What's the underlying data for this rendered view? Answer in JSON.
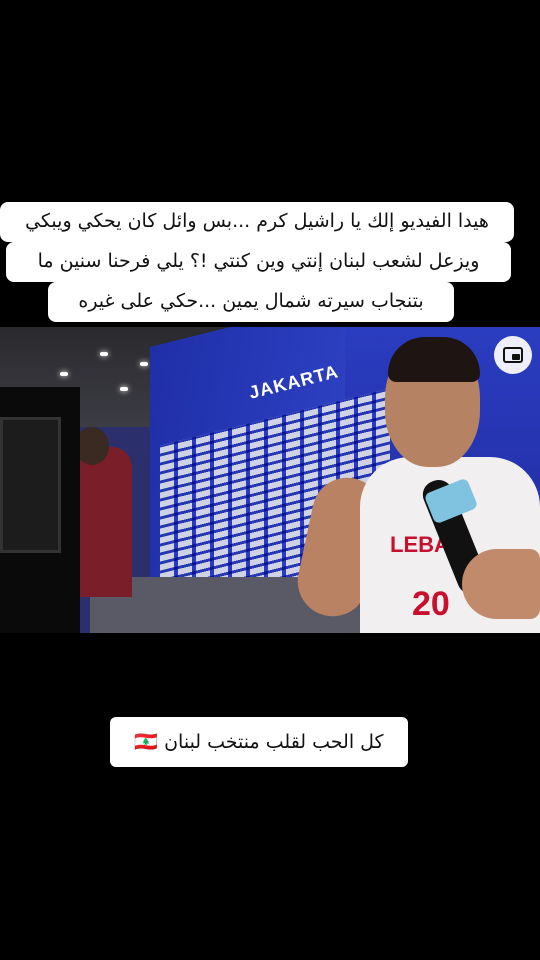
{
  "captions": {
    "line1": "هيدا الفيديو إلك يا راشيل كرم ...بس وائل كان يحكي ويبكي",
    "line2": "ويزعل لشعب لبنان إنتي وين كنتي !؟ يلي فرحنا سنين ما",
    "line3": "بتنجاب سيرته شمال يمين ...حكي على غيره"
  },
  "video": {
    "scene_text": "JAKARTA",
    "jersey_text": "LEBAN",
    "jersey_number": "20",
    "pip_icon": "picture-in-picture-icon"
  },
  "bottom_caption": "كل الحب لقلب منتخب لبنان 🇱🇧",
  "colors": {
    "background": "#000000",
    "caption_bg": "#ffffff",
    "jersey_red": "#c8102e",
    "wall_blue": "#2f44c7"
  }
}
